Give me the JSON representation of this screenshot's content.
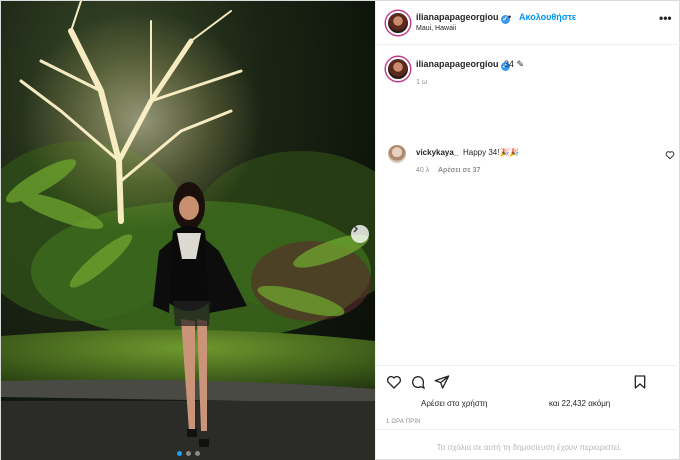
{
  "header": {
    "username": "ilianapapageorgiou",
    "separator": "•",
    "follow_label": "Ακολουθήστε",
    "location": "Maui, Hawaii",
    "more_icon": "more-horizontal-icon"
  },
  "caption": {
    "username": "ilianapapageorgiou",
    "text": "34",
    "time": "1 ω"
  },
  "comments": [
    {
      "username": "vickykaya_",
      "text": "Happy 34!🎉🎉",
      "time": "40 λ",
      "likes": "Αρέσει σε 37"
    }
  ],
  "actions": {
    "icons": [
      "heart-icon",
      "comment-icon",
      "share-icon",
      "bookmark-icon"
    ],
    "likes_prefix": "Αρέσει στο χρήστη",
    "likes_suffix": "και 22,432 ακόμη",
    "post_time": "1 ΩΡΑ ΠΡΙΝ",
    "comments_restricted": "Τα σχόλια σε αυτή τη δημοσίευση έχουν περιοριστεί."
  },
  "carousel": {
    "slides": 3,
    "active_slide": 1
  },
  "colors": {
    "accent": "#0095f6",
    "verified": "#3897f0",
    "muted": "#8e8e8e"
  }
}
